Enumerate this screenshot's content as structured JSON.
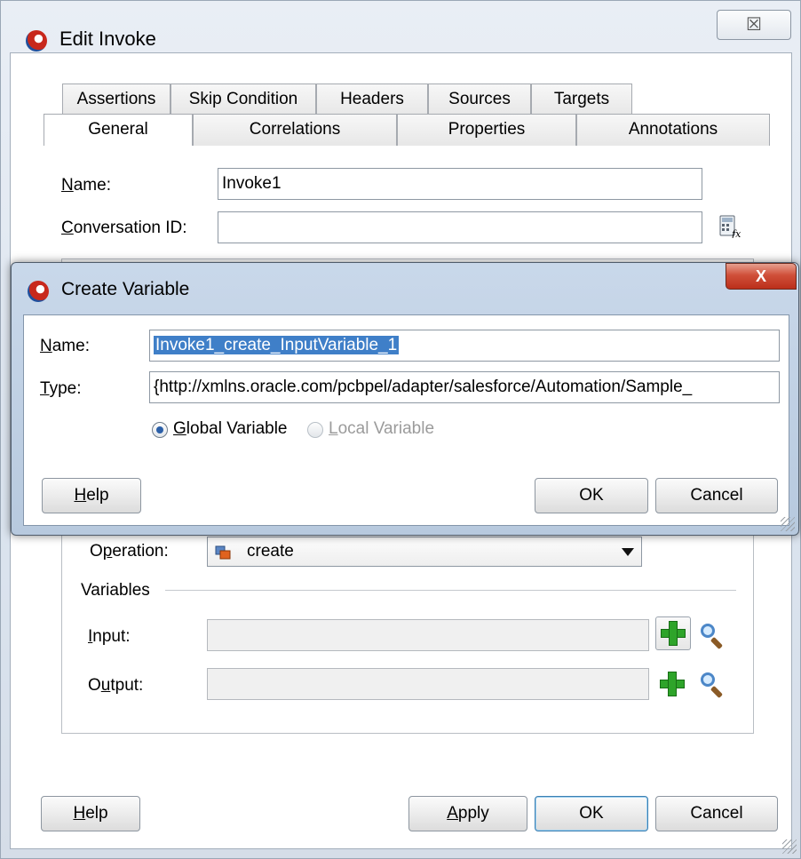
{
  "edit_invoke": {
    "title": "Edit Invoke",
    "close_glyph": "☒",
    "tabs_row1": [
      "Assertions",
      "Skip Condition",
      "Headers",
      "Sources",
      "Targets"
    ],
    "tabs_row2": [
      "General",
      "Correlations",
      "Properties",
      "Annotations"
    ],
    "active_tab": "General",
    "name_label": "Name:",
    "name_value": "Invoke1",
    "conversation_label": "Conversation ID:",
    "conversation_value": "",
    "operation_label": "Operation:",
    "operation_value": "create",
    "variables_label": "Variables",
    "input_label": "Input:",
    "input_value": "",
    "output_label": "Output:",
    "output_value": "",
    "buttons": {
      "help": "Help",
      "apply": "Apply",
      "ok": "OK",
      "cancel": "Cancel"
    }
  },
  "create_variable": {
    "title": "Create Variable",
    "close_glyph": "X",
    "name_label": "Name:",
    "name_value": "Invoke1_create_InputVariable_1",
    "type_label": "Type:",
    "type_value": "{http://xmlns.oracle.com/pcbpel/adapter/salesforce/Automation/Sample_",
    "radio_global": "Global Variable",
    "radio_local": "Local Variable",
    "selected_scope": "Global Variable",
    "buttons": {
      "help": "Help",
      "ok": "OK",
      "cancel": "Cancel"
    }
  },
  "icons": [
    "app-icon",
    "close-icon",
    "expression-builder-icon",
    "operation-icon",
    "add-icon",
    "search-icon",
    "resize-grip-icon"
  ],
  "colors": {
    "selection": "#3f7fc8",
    "add_green": "#2ea42a",
    "dialog_close_red": "#c9402a"
  }
}
